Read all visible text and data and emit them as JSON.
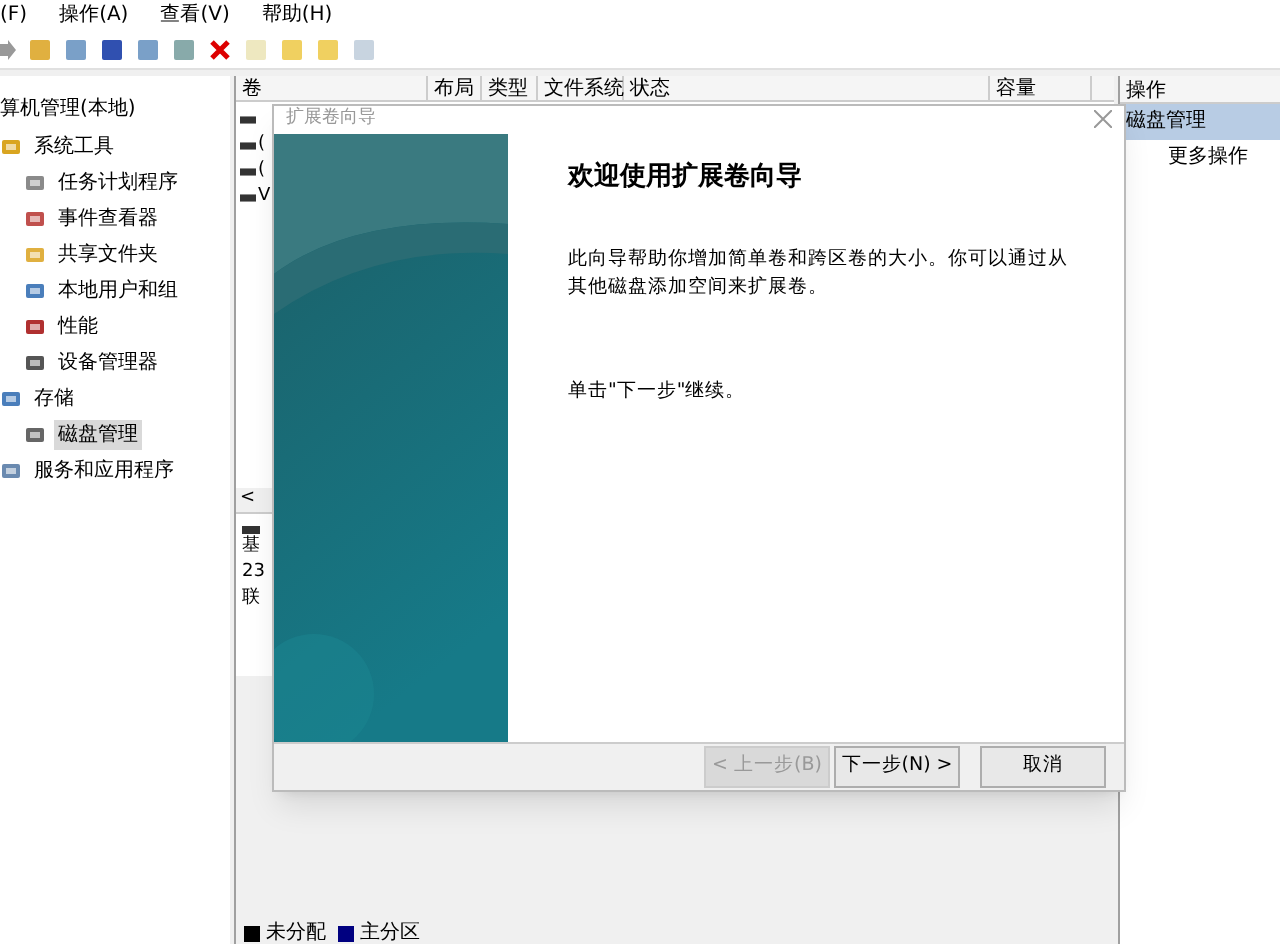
{
  "menu": [
    "(F)",
    "操作(A)",
    "查看(V)",
    "帮助(H)"
  ],
  "tree": {
    "label": "算机管理(本地)",
    "children": [
      {
        "label": "系统工具",
        "children": [
          {
            "label": "任务计划程序",
            "selected": false
          },
          {
            "label": "事件查看器",
            "selected": false
          },
          {
            "label": "共享文件夹",
            "selected": false
          },
          {
            "label": "本地用户和组",
            "selected": false
          },
          {
            "label": "性能",
            "selected": false
          },
          {
            "label": "设备管理器",
            "selected": false
          }
        ]
      },
      {
        "label": "存储",
        "children": [
          {
            "label": "磁盘管理",
            "selected": true
          }
        ]
      },
      {
        "label": "服务和应用程序"
      }
    ]
  },
  "table": {
    "columns": [
      "卷",
      "布局",
      "类型",
      "文件系统",
      "状态",
      "容量"
    ],
    "rows": [
      {
        "volume": ""
      },
      {
        "volume": "("
      },
      {
        "volume": "("
      },
      {
        "volume": "V"
      }
    ]
  },
  "scroll_left": "<",
  "disk_info": [
    "基",
    "23",
    "联"
  ],
  "legend": [
    {
      "label": "未分配",
      "color": "#000000"
    },
    {
      "label": "主分区",
      "color": "#000080"
    }
  ],
  "actions": {
    "title": "操作",
    "items": [
      {
        "label": "磁盘管理",
        "selected": true
      },
      {
        "label": "更多操作",
        "selected": false
      }
    ]
  },
  "dialog": {
    "title": "扩展卷向导",
    "heading": "欢迎使用扩展卷向导",
    "paragraphs": [
      "此向导帮助你增加简单卷和跨区卷的大小。你可以通过从其他磁盘添加空间来扩展卷。",
      "单击\"下一步\"继续。"
    ],
    "buttons": [
      {
        "label": "< 上一步(B)",
        "disabled": true
      },
      {
        "label": "下一步(N) >",
        "disabled": false
      },
      {
        "label": "取消",
        "disabled": false
      }
    ]
  }
}
